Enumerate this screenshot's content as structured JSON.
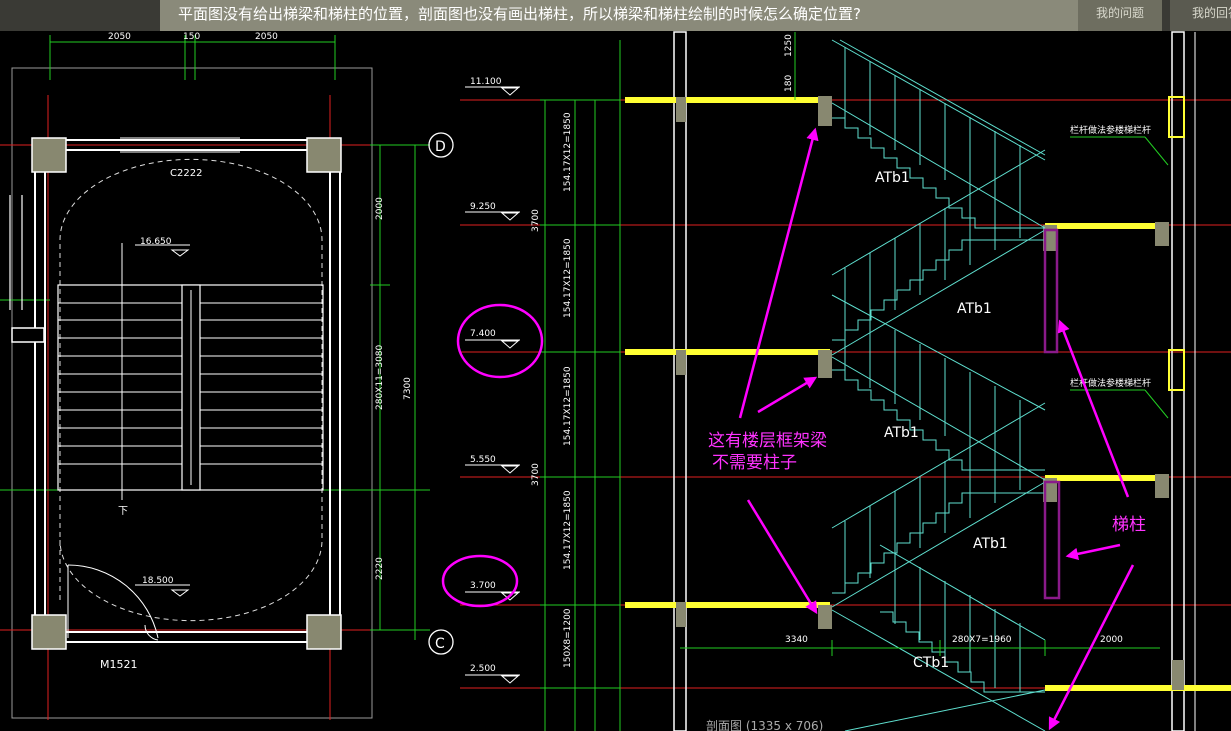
{
  "header": {
    "question": "平面图没有给出梯梁和梯柱的位置，剖面图也没有画出梯柱，所以梯梁和梯柱绘制的时候怎么确定位置?",
    "tab_my_questions": "我的问题",
    "tab_my_answers": "我的回答"
  },
  "plan": {
    "dim_top_left": "2050",
    "dim_top_mid": "150",
    "dim_top_right": "2050",
    "window_label": "C2222",
    "elev_top": "16.650",
    "elev_bottom": "18.500",
    "door_label": "M1521",
    "down_label": "下",
    "axis_d": "D",
    "axis_c": "C",
    "dim_r1": "2000",
    "dim_r2": "280X11=3080",
    "dim_r3": "7300",
    "dim_r4": "2220"
  },
  "section": {
    "elev_1": "11.100",
    "elev_2": "9.250",
    "elev_3": "7.400",
    "elev_4": "5.550",
    "elev_5": "3.700",
    "elev_6": "2.500",
    "vdim_1": "154.17X12=1850",
    "vdim_2": "3700",
    "vdim_3": "154.17X12=1850",
    "vdim_4": "154.17X12=1850",
    "vdim_5": "3700",
    "vdim_6": "154.17X12=1850",
    "vdim_7": "150X8=1200",
    "dim_1250": "1250",
    "dim_180": "180",
    "flight_1": "ATb1",
    "flight_2": "ATb1",
    "flight_3": "ATb1",
    "flight_4": "ATb1",
    "flight_5": "CTb1",
    "railing_note_1": "栏杆做法参楼梯栏杆",
    "railing_note_2": "栏杆做法参楼梯栏杆",
    "dim_3340": "3340",
    "dim_2080": "280X7=1960",
    "dim_2000": "2000",
    "caption": "剖面图 (1335 x 706)"
  },
  "annotations": {
    "beam_note_line1": "这有楼层框架梁",
    "beam_note_line2": "不需要柱子",
    "column_note": "梯柱"
  },
  "colors": {
    "annotation": "#ff33ff",
    "beam": "#ffff33",
    "stair": "#5fe0d0",
    "grid": "#22cc22",
    "axis_red": "#e02020"
  }
}
